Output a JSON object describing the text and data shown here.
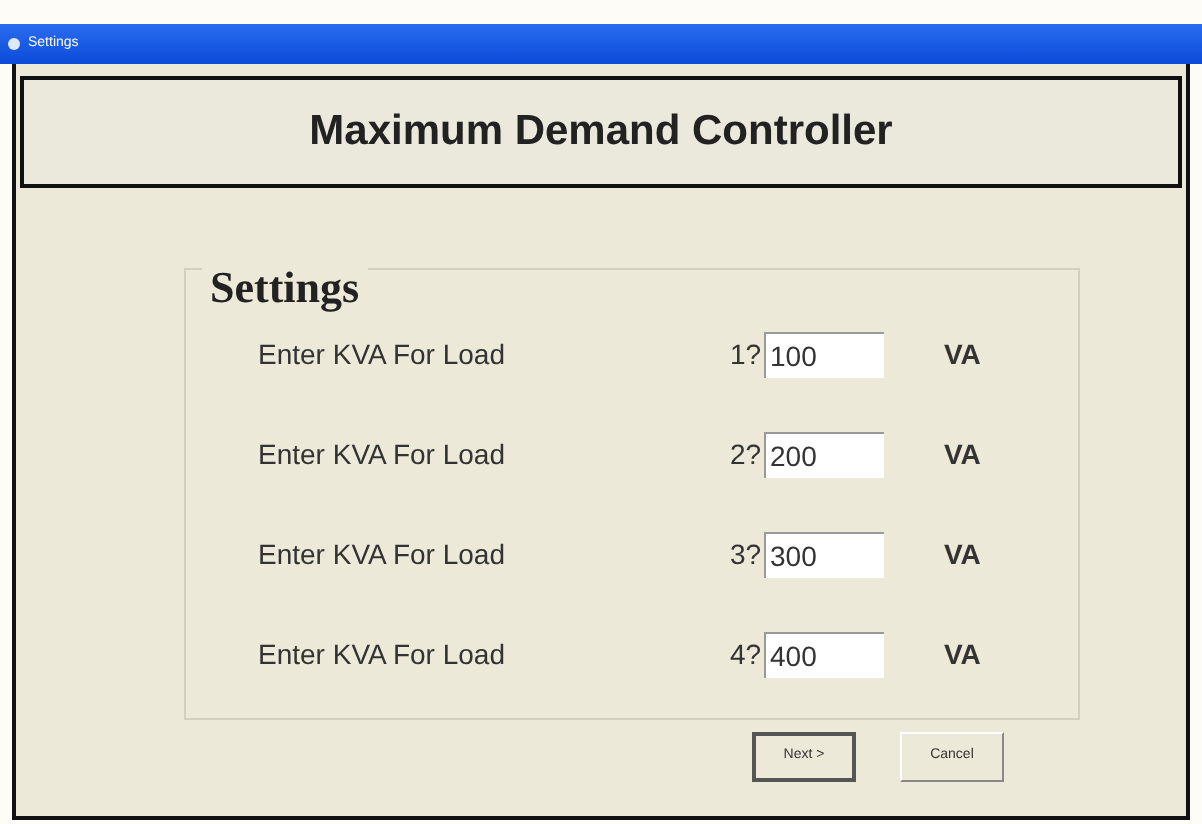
{
  "window": {
    "title": "Settings"
  },
  "header": {
    "title": "Maximum Demand Controller"
  },
  "group": {
    "title": "Settings",
    "rows": [
      {
        "label": "Enter KVA For Load",
        "index": "1?",
        "value": "100",
        "unit": "VA"
      },
      {
        "label": "Enter KVA For Load",
        "index": "2?",
        "value": "200",
        "unit": "VA"
      },
      {
        "label": "Enter KVA For Load",
        "index": "3?",
        "value": "300",
        "unit": "VA"
      },
      {
        "label": "Enter KVA For Load",
        "index": "4?",
        "value": "400",
        "unit": "VA"
      }
    ]
  },
  "buttons": [
    {
      "label": "Next >",
      "default": true
    },
    {
      "label": "Cancel",
      "default": false
    }
  ]
}
